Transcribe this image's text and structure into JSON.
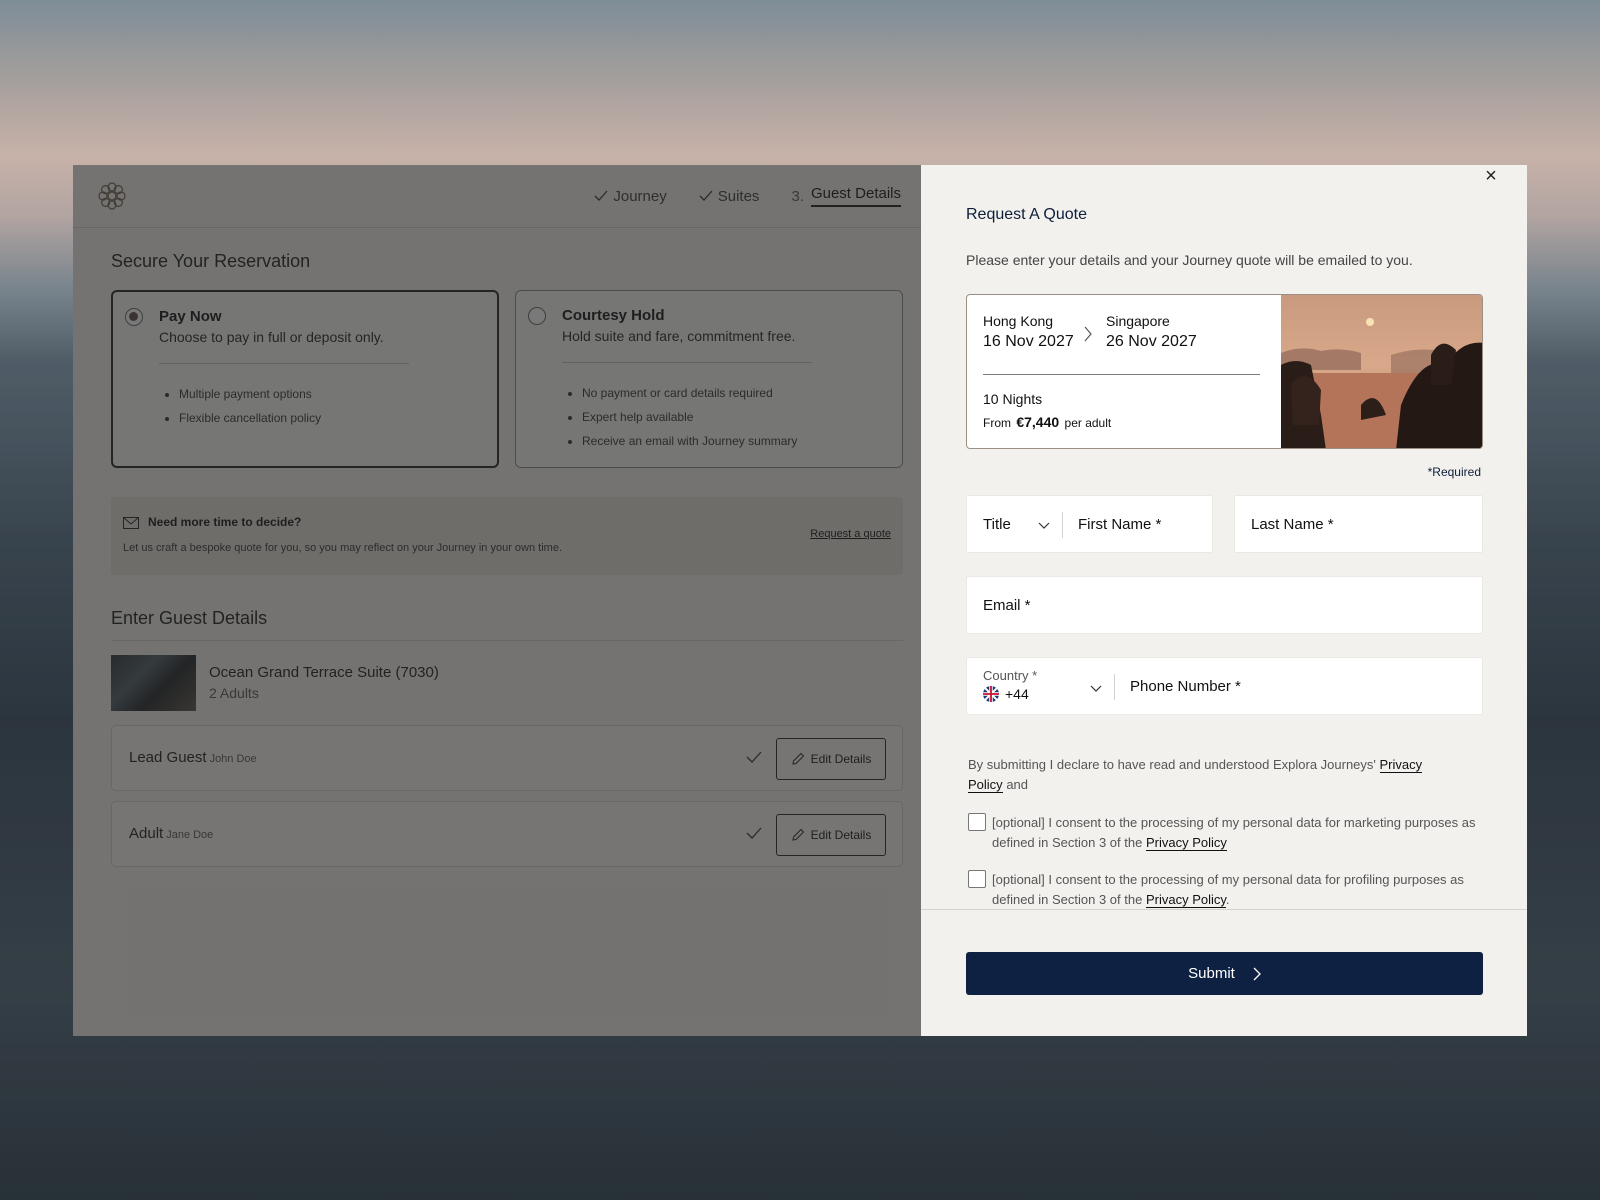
{
  "brand": {
    "logo": "flower-logo-icon"
  },
  "steps": [
    {
      "label": "Journey",
      "done": true
    },
    {
      "label": "Suites",
      "done": true
    },
    {
      "num": "3.",
      "label": "Guest Details",
      "active": true
    }
  ],
  "reservation": {
    "title": "Secure Your Reservation",
    "options": [
      {
        "title": "Pay Now",
        "subtitle": "Choose to pay in full or deposit only.",
        "selected": true,
        "bullets": [
          "Multiple payment options",
          "Flexible cancellation policy"
        ]
      },
      {
        "title": "Courtesy Hold",
        "subtitle": "Hold suite and fare, commitment free.",
        "selected": false,
        "bullets": [
          "No payment or card details required",
          "Expert help available",
          "Receive an email with Journey summary"
        ]
      }
    ],
    "quote_box": {
      "title": "Need more time to decide?",
      "text": "Let us craft a bespoke quote for you, so you may reflect on your Journey in your own time.",
      "link": "Request a quote"
    }
  },
  "guests": {
    "title": "Enter Guest Details",
    "suite_name": "Ocean Grand Terrace Suite (7030)",
    "suite_adults": "2 Adults",
    "rows": [
      {
        "label": "Lead Guest",
        "name": "John Doe",
        "button": "Edit Details"
      },
      {
        "label": "Adult",
        "name": "Jane Doe",
        "button": "Edit Details"
      }
    ]
  },
  "modal": {
    "close": "×",
    "title": "Request A Quote",
    "description": "Please enter your details and your Journey quote will be emailed to you.",
    "journey": {
      "from_city": "Hong Kong",
      "from_date": "16 Nov 2027",
      "to_city": "Singapore",
      "to_date": "26 Nov 2027",
      "nights": "10 Nights",
      "price_prefix": "From",
      "price": "€7,440",
      "price_suffix": "per adult"
    },
    "required_note": "*Required",
    "fields": {
      "title": "Title",
      "first_name": "First Name *",
      "last_name": "Last Name *",
      "email": "Email *",
      "country_label": "Country",
      "country_star": "*",
      "country_code": "+44",
      "phone": "Phone Number *"
    },
    "consent_text_a": "By submitting I declare to have read and understood Explora Journeys'",
    "consent_link": "Privacy Policy",
    "consent_text_b": "and",
    "checkboxes": [
      {
        "text": "[optional] I consent to the processing of my personal data for marketing purposes as defined in Section 3 of the",
        "link": "Privacy Policy",
        "end": ""
      },
      {
        "text": "[optional] I consent to the processing of my personal data for profiling purposes as defined in Section 3 of the",
        "link": "Privacy Policy",
        "end": "."
      }
    ],
    "submit": "Submit"
  },
  "colors": {
    "navy": "#0e2143",
    "accent_border": "#9a8f82"
  }
}
